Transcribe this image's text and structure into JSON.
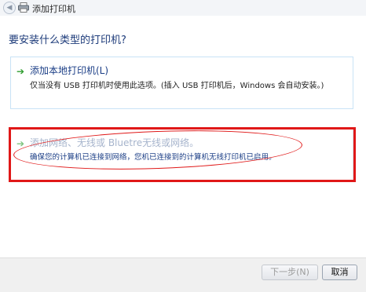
{
  "window": {
    "title": "添加打印机"
  },
  "heading": "要安装什么类型的打印机?",
  "options": [
    {
      "title": "添加本地打印机(L)",
      "description": "仅当没有 USB 打印机时使用此选项。(插入 USB 打印机后，Windows 会自动安装。)"
    },
    {
      "title": "添加网络、无线或 Bluetre无线或网络。",
      "description": "确保您的计算机已连接到网络，您机已连接到的计算机无线打印机已启用。"
    }
  ],
  "buttons": {
    "next": "下一步(N)",
    "cancel": "取消"
  },
  "icons": {
    "back": "back-arrow-icon",
    "printer": "printer-icon",
    "option_arrow": "green-arrow-icon"
  },
  "colors": {
    "highlight": "#e01818",
    "link_blue": "#1b3e86",
    "arrow_green": "#2f9d2f"
  }
}
